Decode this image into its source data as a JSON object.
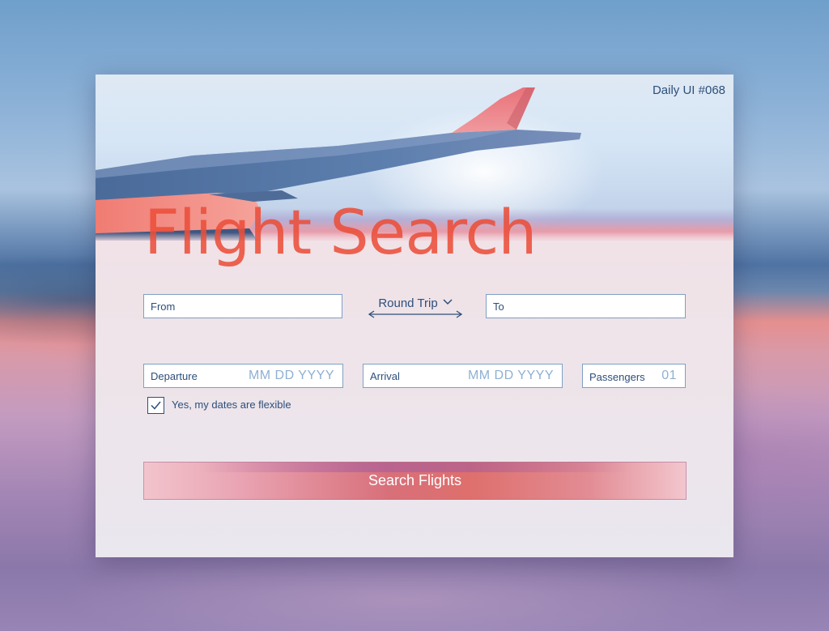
{
  "header": {
    "tag": "Daily UI #068",
    "title": "Flight Search"
  },
  "trip": {
    "from_label": "From",
    "to_label": "To",
    "trip_type": "Round Trip"
  },
  "dates": {
    "departure_label": "Departure",
    "departure_placeholder": "MM DD YYYY",
    "arrival_label": "Arrival",
    "arrival_placeholder": "MM DD YYYY",
    "passengers_label": "Passengers",
    "passengers_value": "01"
  },
  "flexible": {
    "checked": true,
    "label": "Yes, my dates are flexible"
  },
  "actions": {
    "search_label": "Search Flights"
  },
  "colors": {
    "accent_red": "#eb4e3a",
    "text_navy": "#2d4f7a",
    "field_border": "#7f9fc4"
  },
  "icons": [
    "airplane-wing-photo",
    "chevron-down-icon",
    "swap-arrows-icon",
    "checkmark-icon"
  ]
}
